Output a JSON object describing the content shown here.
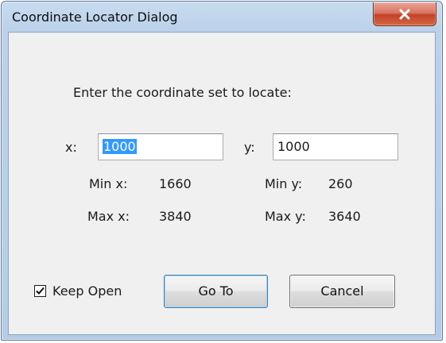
{
  "window": {
    "title": "Coordinate Locator Dialog",
    "close_icon": "close-x-icon"
  },
  "dialog": {
    "prompt": "Enter the coordinate set to locate:",
    "x": {
      "label": "x:",
      "value": "1000",
      "value_selected": true
    },
    "y": {
      "label": "y:",
      "value": "1000"
    },
    "min_x": {
      "label": "Min x:",
      "value": "1660"
    },
    "min_y": {
      "label": "Min y:",
      "value": "260"
    },
    "max_x": {
      "label": "Max x:",
      "value": "3840"
    },
    "max_y": {
      "label": "Max y:",
      "value": "3640"
    },
    "keep_open": {
      "label": "Keep Open",
      "checked": true
    },
    "goto_label": "Go To",
    "cancel_label": "Cancel"
  },
  "colors": {
    "selection": "#3399ff",
    "close_button": "#c4402a",
    "window_frame": "#b4cce6",
    "client_bg": "#f0f0f0"
  }
}
